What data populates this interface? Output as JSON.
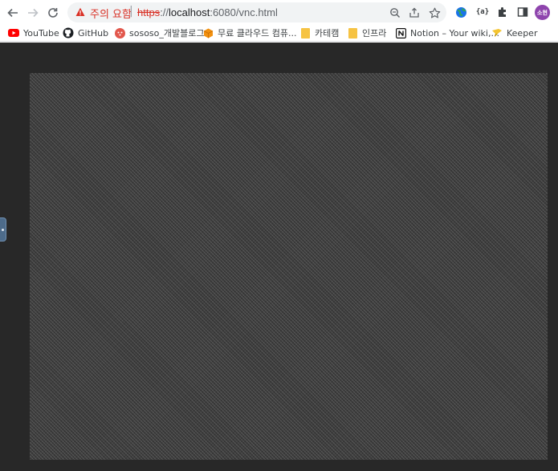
{
  "toolbar": {
    "back_icon": "arrow-left-icon",
    "forward_icon": "arrow-right-icon",
    "reload_icon": "reload-icon"
  },
  "omnibox": {
    "security_warning": "주의 요함",
    "separator": "|",
    "url_scheme": "https",
    "url_sep": "://",
    "url_host": "localhost",
    "url_rest": ":6080/vnc.html",
    "warning_color": "#d93025"
  },
  "extensions": {
    "avatar_text": "소현",
    "avatar_color": "#8e44ad"
  },
  "bookmarks": [
    {
      "label": "YouTube",
      "icon": "youtube-icon"
    },
    {
      "label": "GitHub",
      "icon": "github-icon"
    },
    {
      "label": "sososo_개발블로그",
      "icon": "tistory-icon"
    },
    {
      "label": "무료 클라우드 컴퓨...",
      "icon": "cube-icon"
    },
    {
      "label": "카테캠",
      "icon": "folder-icon"
    },
    {
      "label": "인프라",
      "icon": "folder-icon"
    },
    {
      "label": "Notion – Your wiki,...",
      "icon": "notion-icon"
    },
    {
      "label": "Keeper",
      "icon": "keeper-icon"
    }
  ],
  "content": {
    "background": "#282828",
    "screen_pattern": "checkered-gray",
    "control_bar_handle": "novnc-control-handle"
  }
}
